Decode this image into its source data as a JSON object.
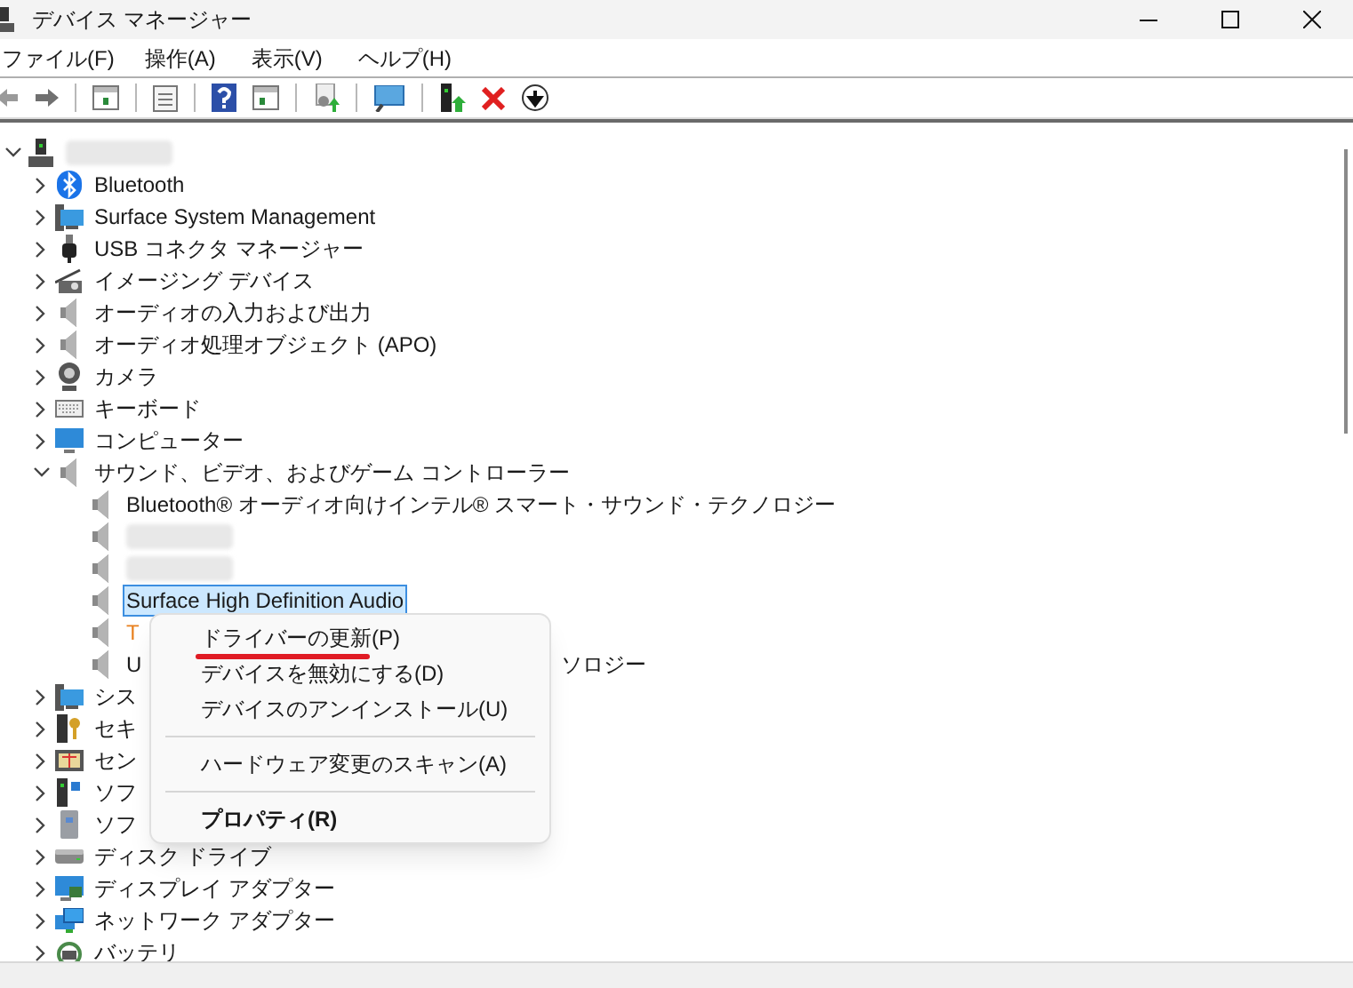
{
  "window": {
    "title": "デバイス マネージャー"
  },
  "menu": [
    {
      "label": "ファイル(F)"
    },
    {
      "label": "操作(A)"
    },
    {
      "label": "表示(V)"
    },
    {
      "label": "ヘルプ(H)"
    }
  ],
  "tree": [
    {
      "kind": "redacted",
      "expanded": true,
      "selected": false,
      "children": [
        {
          "kind": "text",
          "label": "Bluetooth",
          "expanded": false,
          "selected": false
        },
        {
          "kind": "text",
          "label": "Surface System Management",
          "expanded": false,
          "selected": false
        },
        {
          "kind": "text",
          "label": "USB コネクタ マネージャー",
          "expanded": false,
          "selected": false
        },
        {
          "kind": "text",
          "label": "イメージング デバイス",
          "expanded": false,
          "selected": false
        },
        {
          "kind": "text",
          "label": "オーディオの入力および出力",
          "expanded": false,
          "selected": false
        },
        {
          "kind": "text",
          "label": "オーディオ処理オブジェクト (APO)",
          "expanded": false,
          "selected": false
        },
        {
          "kind": "text",
          "label": "カメラ",
          "expanded": false,
          "selected": false
        },
        {
          "kind": "text",
          "label": "キーボード",
          "expanded": false,
          "selected": false
        },
        {
          "kind": "text",
          "label": "コンピューター",
          "expanded": false,
          "selected": false
        },
        {
          "kind": "text",
          "label": "サウンド、ビデオ、およびゲーム コントローラー",
          "expanded": true,
          "selected": false,
          "children": [
            {
              "kind": "text",
              "label": "Bluetooth® オーディオ向けインテル® スマート・サウンド・テクノロジー",
              "selected": false
            },
            {
              "kind": "redacted",
              "selected": false
            },
            {
              "kind": "redacted",
              "selected": false
            },
            {
              "kind": "text",
              "label": "Surface High Definition Audio",
              "selected": true
            },
            {
              "kind": "text",
              "label": "T",
              "color": "#e8801e",
              "selected": false
            },
            {
              "kind": "text",
              "label": "U",
              "tail": "ソロジー",
              "selected": false
            }
          ]
        },
        {
          "kind": "text",
          "label": "シス",
          "expanded": false,
          "selected": false
        },
        {
          "kind": "text",
          "label": "セキ",
          "expanded": false,
          "selected": false
        },
        {
          "kind": "text",
          "label": "セン",
          "expanded": false,
          "selected": false
        },
        {
          "kind": "text",
          "label": "ソフ",
          "expanded": false,
          "selected": false
        },
        {
          "kind": "text",
          "label": "ソフ",
          "expanded": false,
          "selected": false
        },
        {
          "kind": "text",
          "label": "ディスク ドライブ",
          "expanded": false,
          "selected": false
        },
        {
          "kind": "text",
          "label": "ディスプレイ アダプター",
          "expanded": false,
          "selected": false
        },
        {
          "kind": "text",
          "label": "ネットワーク アダプター",
          "expanded": false,
          "selected": false
        },
        {
          "kind": "text",
          "label": "バッテリ",
          "expanded": false,
          "selected": false
        }
      ]
    }
  ],
  "context_menu": [
    {
      "kind": "item",
      "label": "ドライバーの更新(P)",
      "bold": false,
      "marked": true
    },
    {
      "kind": "item",
      "label": "デバイスを無効にする(D)",
      "bold": false,
      "marked": false
    },
    {
      "kind": "item",
      "label": "デバイスのアンインストール(U)",
      "bold": false,
      "marked": false
    },
    {
      "kind": "separator"
    },
    {
      "kind": "item",
      "label": "ハードウェア変更のスキャン(A)",
      "bold": false,
      "marked": false
    },
    {
      "kind": "separator"
    },
    {
      "kind": "item",
      "label": "プロパティ(R)",
      "bold": true,
      "marked": false
    }
  ]
}
